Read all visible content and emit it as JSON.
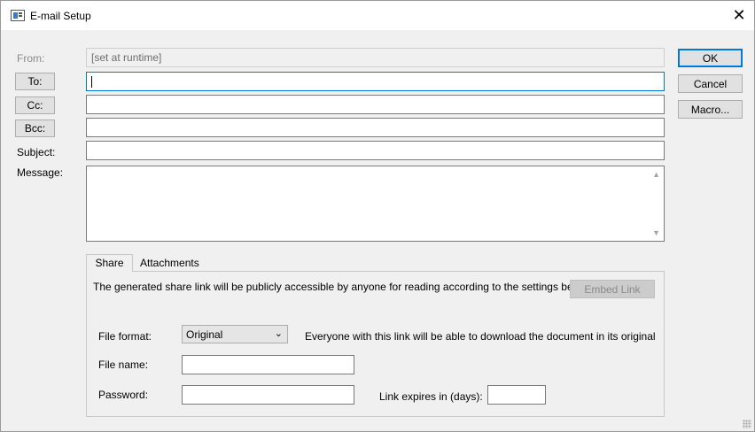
{
  "window": {
    "title": "E-mail Setup",
    "close_symbol": "✕"
  },
  "form": {
    "from_label": "From:",
    "from_value": "[set at runtime]",
    "to_button": "To:",
    "cc_button": "Cc:",
    "bcc_button": "Bcc:",
    "subject_label": "Subject:",
    "message_label": "Message:",
    "to_value": "",
    "cc_value": "",
    "bcc_value": "",
    "subject_value": ""
  },
  "buttons": {
    "ok": "OK",
    "cancel": "Cancel",
    "macro": "Macro..."
  },
  "tabs": [
    {
      "label": "Share",
      "active": true
    },
    {
      "label": "Attachments",
      "active": false
    }
  ],
  "share": {
    "info": "The generated share link will be publicly accessible by anyone for reading according to the settings below.",
    "embed_link": "Embed Link",
    "file_format_label": "File format:",
    "file_format_value": "Original",
    "file_format_note": "Everyone with this link will be able to download the document in its original",
    "file_name_label": "File name:",
    "password_label": "Password:",
    "expires_label": "Link expires in (days):"
  },
  "colors": {
    "accent": "#0078d7",
    "background": "#f0f0f0"
  }
}
